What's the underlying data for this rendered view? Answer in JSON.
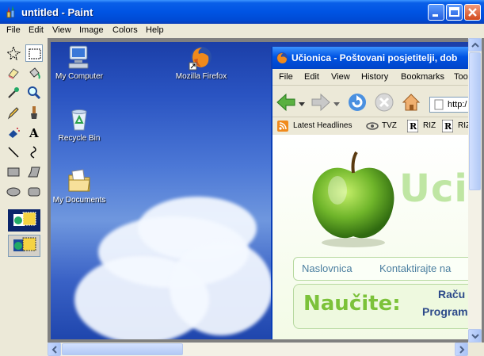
{
  "window": {
    "title": "untitled - Paint"
  },
  "menu": {
    "items": [
      "File",
      "Edit",
      "View",
      "Image",
      "Colors",
      "Help"
    ]
  },
  "toolbox": {
    "tools": [
      "free-select",
      "rect-select",
      "eraser",
      "fill",
      "color-picker",
      "magnifier",
      "pencil",
      "brush",
      "airbrush",
      "text",
      "line",
      "curve",
      "rectangle",
      "polygon",
      "ellipse",
      "rounded-rectangle"
    ],
    "selected_tool": "rect-select"
  },
  "desktop": {
    "icons": [
      {
        "label": "My Computer"
      },
      {
        "label": "Mozilla Firefox"
      },
      {
        "label": "Recycle Bin"
      },
      {
        "label": "My Documents"
      }
    ]
  },
  "browser": {
    "title": "Učionica - Poštovani posjetitelji, dob",
    "menus": [
      "File",
      "Edit",
      "View",
      "History",
      "Bookmarks",
      "Too"
    ],
    "url": "http:/",
    "bookmarks": [
      "Latest Headlines",
      "TVZ",
      "RIZ",
      "RIZ"
    ],
    "page": {
      "logo_text": "Ucio",
      "nav_links": [
        "Naslovnica",
        "Kontaktirajte na"
      ],
      "promo_title": "Naučite:",
      "promo_line1": "Raču",
      "promo_line2": "Program"
    }
  },
  "colors": {
    "titlebar": "#0054e3",
    "chrome": "#ece9d8",
    "desktop_sky": "#2a54c2",
    "promo_green": "#7cc23a"
  }
}
